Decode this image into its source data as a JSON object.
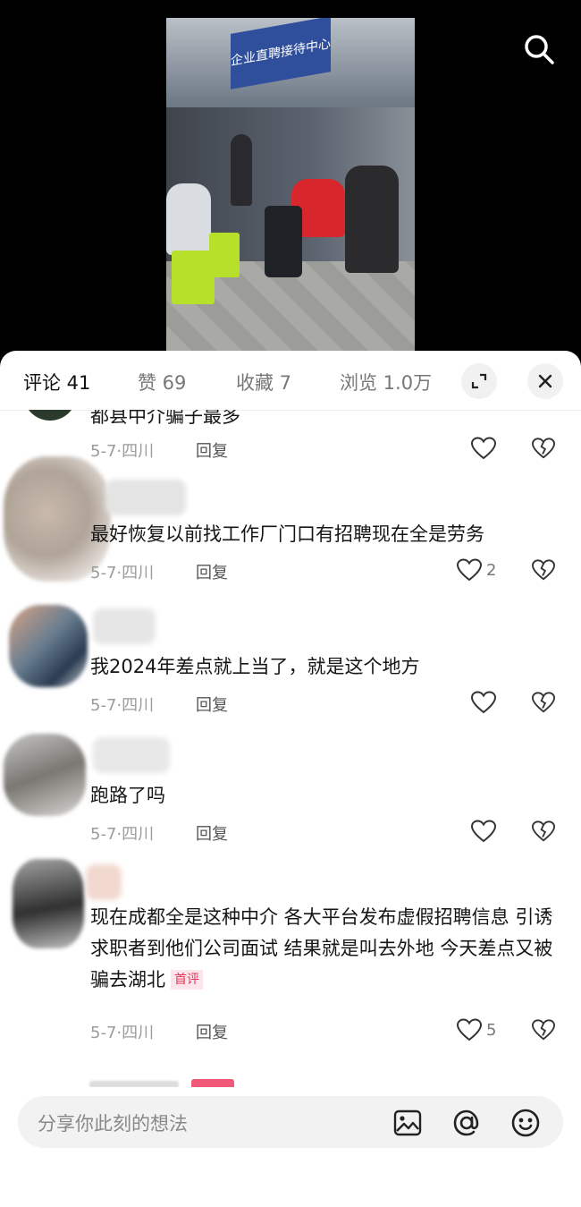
{
  "video": {
    "sign_text": "企业直聘接待中心"
  },
  "header_actions": {
    "search_icon": "search-icon"
  },
  "tabs": [
    {
      "label": "评论 41",
      "active": true
    },
    {
      "label": "赞 69"
    },
    {
      "label": "收藏 7"
    },
    {
      "label": "浏览 1.0万"
    }
  ],
  "sheet_buttons": {
    "expand_icon": "expand-icon",
    "close_icon": "close-icon"
  },
  "comments": [
    {
      "text": "都县中介骗子最多",
      "meta": "5-7·四川",
      "reply": "回复",
      "likes": ""
    },
    {
      "text": "最好恢复以前找工作厂门口有招聘现在全是劳务",
      "meta": "5-7·四川",
      "reply": "回复",
      "likes": "2"
    },
    {
      "text": "我2024年差点就上当了，就是这个地方",
      "meta": "5-7·四川",
      "reply": "回复",
      "likes": ""
    },
    {
      "text": "跑路了吗",
      "meta": "5-7·四川",
      "reply": "回复",
      "likes": ""
    },
    {
      "text": "现在成都全是这种中介 各大平台发布虚假招聘信息 引诱求职者到他们公司面试 结果就是叫去外地 今天差点又被骗去湖北",
      "badge": "首评",
      "meta": "5-7·四川",
      "reply": "回复",
      "likes": "5"
    }
  ],
  "input": {
    "placeholder": "分享你此刻的想法",
    "icons": [
      "image-icon",
      "at-icon",
      "emoji-icon"
    ]
  }
}
